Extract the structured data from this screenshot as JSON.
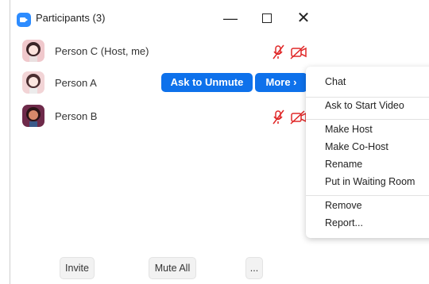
{
  "window": {
    "title": "Participants (3)",
    "minimize_glyph": "—",
    "close_glyph": "✕"
  },
  "participants": [
    {
      "name": "Person C (Host, me)",
      "muted": true,
      "video_off": true,
      "avatar_bg": "#f0c8cc"
    },
    {
      "name": "Person A",
      "muted": true,
      "video_off": true,
      "avatar_bg": "#f2d4d6"
    },
    {
      "name": "Person B",
      "muted": true,
      "video_off": true,
      "avatar_bg": "#6e2a4a"
    }
  ],
  "hover_actions": {
    "ask_to_unmute": "Ask to Unmute",
    "more": "More ›"
  },
  "context_menu": {
    "items": [
      "Chat",
      "Ask to Start Video",
      "Make Host",
      "Make Co-Host",
      "Rename",
      "Put in Waiting Room",
      "Remove",
      "Report..."
    ]
  },
  "footer": {
    "invite": "Invite",
    "mute_all": "Mute All",
    "more": "..."
  },
  "colors": {
    "accent": "#0e71eb",
    "muted_icon": "#e02828",
    "app_icon": "#2d8cff"
  }
}
